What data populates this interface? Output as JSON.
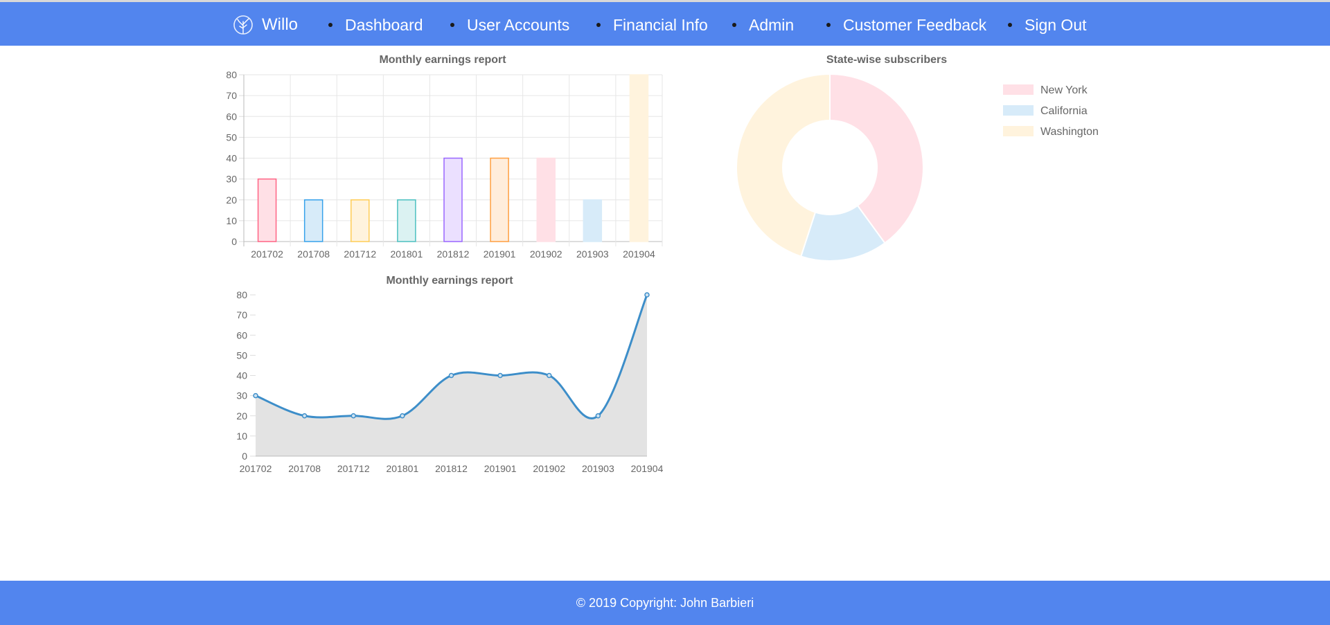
{
  "nav": {
    "brand": "Willo",
    "items": [
      {
        "label": "Dashboard",
        "name": "nav-item-dashboard"
      },
      {
        "label": "User Accounts",
        "name": "nav-item-user-accounts"
      },
      {
        "label": "Financial Info",
        "name": "nav-item-financial-info"
      },
      {
        "label": "Admin",
        "name": "nav-item-admin"
      },
      {
        "label": "Customer Feedback",
        "name": "nav-item-customer-feedback"
      },
      {
        "label": "Sign Out",
        "name": "nav-item-sign-out"
      }
    ]
  },
  "footer": {
    "text": "© 2019 Copyright: John Barbieri"
  },
  "colors": {
    "navbar": "#5285ee",
    "line": "#3d8ec9",
    "area": "#e3e3e3"
  },
  "chart_data": [
    {
      "type": "bar",
      "title": "Monthly earnings report",
      "categories": [
        "201702",
        "201708",
        "201712",
        "201801",
        "201812",
        "201901",
        "201902",
        "201903",
        "201904"
      ],
      "values": [
        30,
        20,
        20,
        20,
        40,
        40,
        40,
        20,
        80
      ],
      "ylim": [
        0,
        80
      ],
      "yticks": [
        0,
        10,
        20,
        30,
        40,
        50,
        60,
        70,
        80
      ],
      "grid": true,
      "bar_colors": [
        {
          "fill": "#ffe0e6",
          "stroke": "#ff6384"
        },
        {
          "fill": "#d7ebf9",
          "stroke": "#36a2eb"
        },
        {
          "fill": "#fff3dd",
          "stroke": "#ffcd56"
        },
        {
          "fill": "#dbf2f2",
          "stroke": "#4bc0c0"
        },
        {
          "fill": "#ebe0ff",
          "stroke": "#9966ff"
        },
        {
          "fill": "#ffeddb",
          "stroke": "#ff9f40"
        },
        {
          "fill": "#ffe0e6",
          "stroke": "#ffe0e6"
        },
        {
          "fill": "#d7ebf9",
          "stroke": "#d7ebf9"
        },
        {
          "fill": "#fff3dd",
          "stroke": "#fff3dd"
        }
      ]
    },
    {
      "type": "area",
      "title": "Monthly earnings report",
      "categories": [
        "201702",
        "201708",
        "201712",
        "201801",
        "201812",
        "201901",
        "201902",
        "201903",
        "201904"
      ],
      "values": [
        30,
        20,
        20,
        20,
        40,
        40,
        40,
        20,
        80
      ],
      "ylim": [
        0,
        80
      ],
      "yticks": [
        0,
        10,
        20,
        30,
        40,
        50,
        60,
        70,
        80
      ],
      "grid": false
    },
    {
      "type": "pie",
      "title": "State-wise subscribers",
      "labels": [
        "New York",
        "California",
        "Washington"
      ],
      "values": [
        40,
        15,
        45
      ],
      "colors": [
        "#ffe0e6",
        "#d7ebf9",
        "#fff3dd"
      ],
      "legend": "right"
    }
  ]
}
